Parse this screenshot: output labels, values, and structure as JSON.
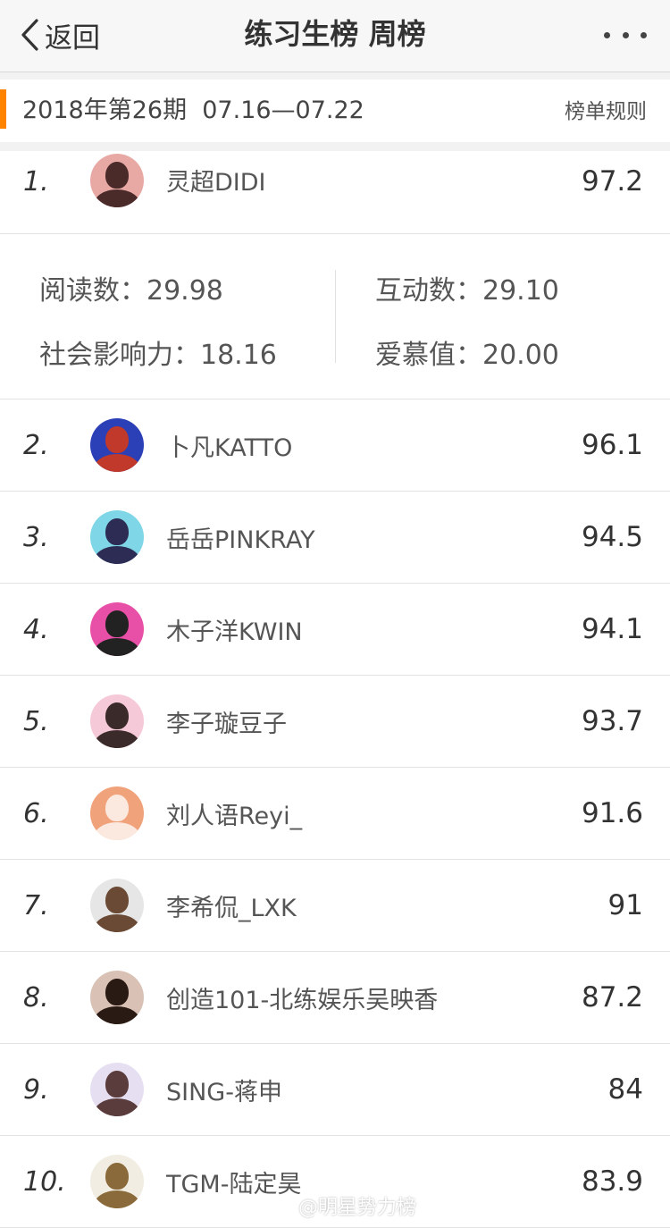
{
  "nav": {
    "back_label": "返回",
    "title": "练习生榜 周榜"
  },
  "period": {
    "label": "2018年第26期",
    "range": "07.16—07.22",
    "rules_label": "榜单规则"
  },
  "colors": {
    "accent": "#ff8200"
  },
  "first_entry_stats": {
    "read_label": "阅读数：",
    "read_value": "29.98",
    "interact_label": "互动数：",
    "interact_value": "29.10",
    "influence_label": "社会影响力：",
    "influence_value": "18.16",
    "love_label": "爱慕值：",
    "love_value": "20.00"
  },
  "ranking": [
    {
      "rank": "1.",
      "name": "灵超DIDI",
      "score": "97.2",
      "avatar_bg": "#e8a9a4",
      "avatar_fg": "#4b2a2a"
    },
    {
      "rank": "2.",
      "name": "卜凡KATTO",
      "score": "96.1",
      "avatar_bg": "#2b3fb6",
      "avatar_fg": "#c0392b"
    },
    {
      "rank": "3.",
      "name": "岳岳PINKRAY",
      "score": "94.5",
      "avatar_bg": "#7fd6e6",
      "avatar_fg": "#2c2c54"
    },
    {
      "rank": "4.",
      "name": "木子洋KWIN",
      "score": "94.1",
      "avatar_bg": "#e84fa6",
      "avatar_fg": "#222222"
    },
    {
      "rank": "5.",
      "name": "李子璇豆子",
      "score": "93.7",
      "avatar_bg": "#f6c9d8",
      "avatar_fg": "#3a2a2a"
    },
    {
      "rank": "6.",
      "name": "刘人语Reyi_",
      "score": "91.6",
      "avatar_bg": "#f0a27a",
      "avatar_fg": "#fbe9e0"
    },
    {
      "rank": "7.",
      "name": "李希侃_LXK",
      "score": "91",
      "avatar_bg": "#e6e6e6",
      "avatar_fg": "#6b4a35"
    },
    {
      "rank": "8.",
      "name": "创造101-北练娱乐吴映香",
      "score": "87.2",
      "avatar_bg": "#d9c2b5",
      "avatar_fg": "#2a1a14"
    },
    {
      "rank": "9.",
      "name": "SING-蒋申",
      "score": "84",
      "avatar_bg": "#e6dff2",
      "avatar_fg": "#5a3c3c"
    },
    {
      "rank": "10.",
      "name": "TGM-陆定昊",
      "score": "83.9",
      "avatar_bg": "#f1ede2",
      "avatar_fg": "#8a6a3a"
    }
  ],
  "watermark": {
    "text": "@明星势力榜",
    "icon": "weibo-icon"
  }
}
